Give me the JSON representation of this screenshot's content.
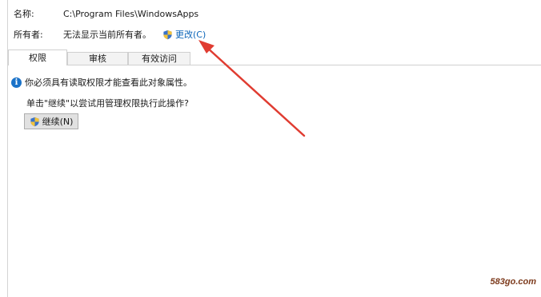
{
  "header": {
    "name_label": "名称:",
    "name_value": "C:\\Program Files\\WindowsApps",
    "owner_label": "所有者:",
    "owner_value": "无法显示当前所有者。",
    "change_link": "更改(C)"
  },
  "tabs": [
    {
      "label": "权限",
      "active": true
    },
    {
      "label": "审核",
      "active": false
    },
    {
      "label": "有效访问",
      "active": false
    }
  ],
  "main": {
    "info_text": "你必须具有读取权限才能查看此对象属性。",
    "prompt_text": "单击\"继续\"以尝试用管理权限执行此操作?",
    "continue_button": "继续(N)"
  },
  "watermark": "583go.com",
  "colors": {
    "link": "#0a64b8",
    "annotation_arrow": "#e03c31",
    "info_icon": "#1a72c8"
  },
  "icons": [
    "uac-shield-icon",
    "info-icon",
    "annotation-arrow"
  ]
}
